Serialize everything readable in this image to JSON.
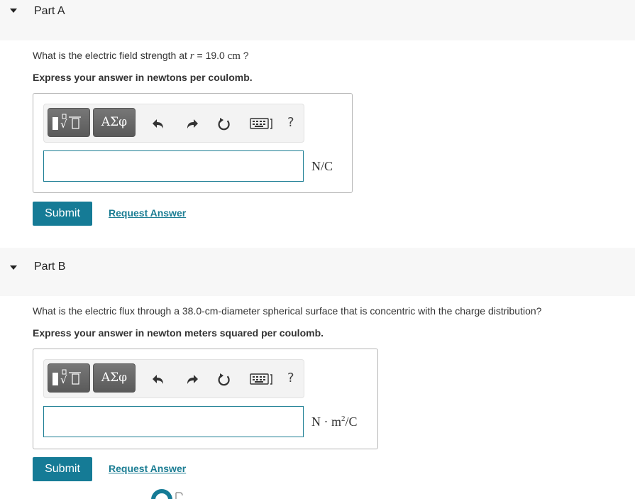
{
  "partA": {
    "title": "Part A",
    "question_prefix": "What is the electric field strength at ",
    "question_var": "r",
    "question_eq": " = ",
    "question_value": "19.0",
    "question_unit": "cm",
    "question_suffix": " ?",
    "instruction": "Express your answer in newtons per coulomb.",
    "symbols_label": "ΑΣφ",
    "help_label": "?",
    "unit": "N/C",
    "answer_value": "",
    "submit_label": "Submit",
    "request_label": "Request Answer"
  },
  "partB": {
    "title": "Part B",
    "question": "What is the electric flux through a 38.0-cm-diameter spherical surface that is concentric with the charge distribution?",
    "instruction": "Express your answer in newton meters squared per coulomb.",
    "symbols_label": "ΑΣφ",
    "help_label": "?",
    "unit_n": "N",
    "unit_dot": " · ",
    "unit_m": "m",
    "unit_exp": "2",
    "unit_tail": "/C",
    "answer_value": "",
    "submit_label": "Submit",
    "request_label": "Request Answer"
  },
  "colors": {
    "accent": "#157b96",
    "link": "#1b7d93",
    "header_bg": "#f7f7f7"
  },
  "icons": [
    "caret-down-icon",
    "template-icon",
    "undo-icon",
    "redo-icon",
    "reset-icon",
    "keyboard-icon",
    "help-icon"
  ]
}
